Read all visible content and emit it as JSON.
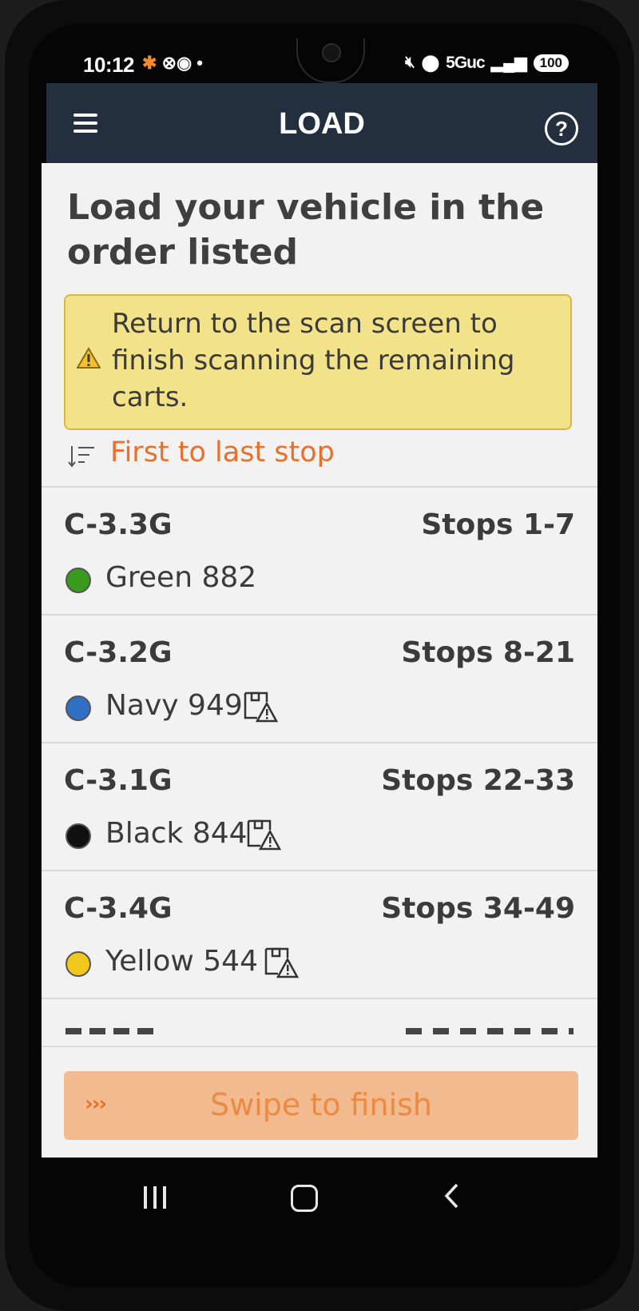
{
  "status_bar": {
    "time": "10:12",
    "left_icons": "✱ »Ⓘ •",
    "network": "5Guc",
    "battery": "100"
  },
  "header": {
    "title": "LOAD",
    "help_symbol": "?"
  },
  "page": {
    "title": "Load your vehicle in the order listed",
    "warning": "Return to the scan screen to finish scanning the remaining carts.",
    "sort_label": "First to last stop"
  },
  "carts": [
    {
      "code": "C-3.3G",
      "stops": "Stops 1-7",
      "color_label": "Green 882",
      "color": "#3a9a1e",
      "damage_flag": false
    },
    {
      "code": "C-3.2G",
      "stops": "Stops 8-21",
      "color_label": "Navy 949",
      "color": "#2f6fc4",
      "damage_flag": true
    },
    {
      "code": "C-3.1G",
      "stops": "Stops 22-33",
      "color_label": "Black 844",
      "color": "#111111",
      "damage_flag": true
    },
    {
      "code": "C-3.4G",
      "stops": "Stops 34-49",
      "color_label": "Yellow 544",
      "color": "#f2c81d",
      "damage_flag": true
    }
  ],
  "footer": {
    "swipe_label": "Swipe to finish",
    "swipe_chevrons": "›››"
  },
  "colors": {
    "header_bg": "#232f3e",
    "accent_orange": "#e8702a",
    "warning_bg": "#f2e38b",
    "swipe_bg": "#f2bb8f"
  },
  "icons": {
    "menu": "hamburger-menu-icon",
    "help": "help-circle-icon",
    "warning": "warning-triangle-icon",
    "sort": "sort-descending-icon",
    "damage": "damaged-package-icon"
  }
}
